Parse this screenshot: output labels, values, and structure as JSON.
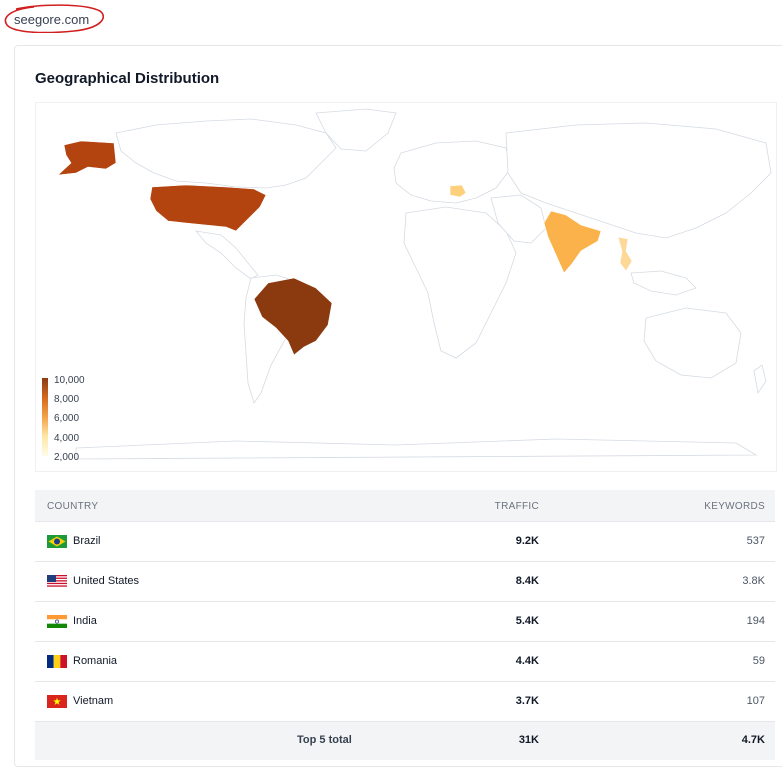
{
  "domain": "seegore.com",
  "card": {
    "title": "Geographical Distribution"
  },
  "legend": {
    "labels": [
      "10,000",
      "8,000",
      "6,000",
      "4,000",
      "2,000"
    ]
  },
  "colors": {
    "brazil": "#8b3a0f",
    "united_states": "#b34410",
    "india": "#fbb24a",
    "romania": "#fdd07b",
    "vietnam": "#fdd896",
    "land_outline": "#d5dbe3",
    "domain_circle": "#d11f1f"
  },
  "table": {
    "headers": {
      "country": "COUNTRY",
      "traffic": "TRAFFIC",
      "keywords": "KEYWORDS"
    },
    "rows": [
      {
        "country": "Brazil",
        "flag": "brazil-flag-icon",
        "traffic": "9.2K",
        "keywords": "537"
      },
      {
        "country": "United States",
        "flag": "us-flag-icon",
        "traffic": "8.4K",
        "keywords": "3.8K"
      },
      {
        "country": "India",
        "flag": "india-flag-icon",
        "traffic": "5.4K",
        "keywords": "194"
      },
      {
        "country": "Romania",
        "flag": "romania-flag-icon",
        "traffic": "4.4K",
        "keywords": "59"
      },
      {
        "country": "Vietnam",
        "flag": "vietnam-flag-icon",
        "traffic": "3.7K",
        "keywords": "107"
      }
    ],
    "total": {
      "label": "Top 5 total",
      "traffic": "31K",
      "keywords": "4.7K"
    }
  }
}
